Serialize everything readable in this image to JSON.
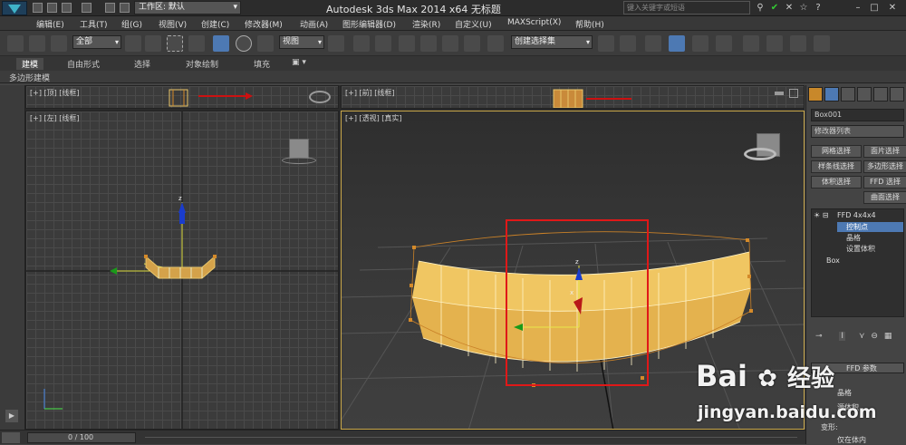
{
  "titlebar": {
    "workspace_label": "工作区: 默认",
    "title": "Autodesk 3ds Max  2014 x64      无标题",
    "search_placeholder": "键入关键字或短语"
  },
  "menu": [
    "编辑(E)",
    "工具(T)",
    "组(G)",
    "视图(V)",
    "创建(C)",
    "修改器(M)",
    "动画(A)",
    "图形编辑器(D)",
    "渲染(R)",
    "自定义(U)",
    "MAXScript(X)",
    "帮助(H)"
  ],
  "toolbar": {
    "selection_filter": "全部",
    "ref_coord": "视图",
    "named_selection": "创建选择集"
  },
  "ribbon": {
    "tabs": [
      "建模",
      "自由形式",
      "选择",
      "对象绘制",
      "填充"
    ],
    "sub": "多边形建模"
  },
  "viewports": {
    "top_label": "[+] [顶] [线框]",
    "front_label": "[+] [前] [线框]",
    "left_label": "[+] [左] [线框]",
    "persp_label": "[+] [透视] [真实]",
    "axis_z": "z",
    "axis_x": "x"
  },
  "command_panel": {
    "object_name": "Box001",
    "modifier_list": "修改器列表",
    "buttons": [
      "网格选择",
      "面片选择",
      "样条线选择",
      "多边形选择",
      "体积选择",
      "FFD 选择",
      "曲面选择"
    ],
    "stack": {
      "ffd": "FFD 4x4x4",
      "control_points": "控制点",
      "lattice": "晶格",
      "set_volume": "设置体积",
      "box": "Box"
    },
    "rollout_title": "FFD 参数",
    "rollout_items": [
      "晶格",
      "源体积",
      "变形:",
      "仅在体内"
    ]
  },
  "statusbar": {
    "time": "0 / 100"
  },
  "watermark": {
    "brand": "Bai",
    "brand2": "经验",
    "url": "jingyan.baidu.com"
  },
  "colors": {
    "mesh": "#e8c66a",
    "lattice": "#d48a2a",
    "highlight_box": "#e01818",
    "selected": "#4d79b3"
  }
}
